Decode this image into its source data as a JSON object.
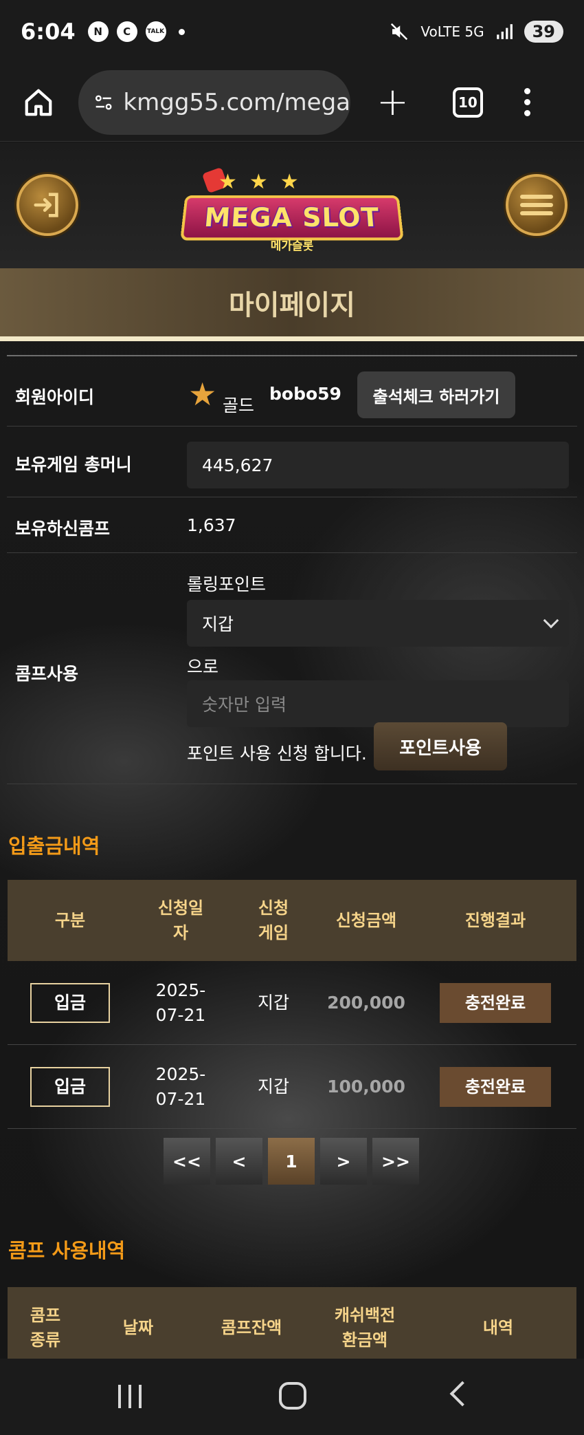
{
  "status_bar": {
    "time": "6:04",
    "notif_icons": [
      "N",
      "C",
      "TALK"
    ],
    "network": "VoLTE 5G",
    "battery": "39"
  },
  "browser": {
    "url": "kmgg55.com/mega",
    "tab_count": "10"
  },
  "site": {
    "logo_title": "MEGA SLOT",
    "logo_sub": "메가슬롯",
    "page_title": "마이페이지"
  },
  "member": {
    "id_label": "회원아이디",
    "grade": "골드",
    "user_id": "bobo59",
    "attendance_button": "출석체크 하러가기",
    "money_label": "보유게임 총머니",
    "money_value": "445,627",
    "comp_label": "보유하신콤프",
    "comp_value": "1,637",
    "use_label": "콤프사용",
    "rolling_label": "롤링포인트",
    "wallet_select": "지갑",
    "to_text": "으로",
    "amount_placeholder": "숫자만 입력",
    "apply_text": "포인트 사용 신청 합니다.",
    "use_point_button": "포인트사용"
  },
  "deposit_history": {
    "title": "입출금내역",
    "headers": [
      "구분",
      "신청일\n자",
      "신청\n게임",
      "신청금액",
      "진행결과"
    ],
    "rows": [
      {
        "type": "입금",
        "date": "2025-\n07-21",
        "game": "지갑",
        "amount": "200,000",
        "status": "충전완료"
      },
      {
        "type": "입금",
        "date": "2025-\n07-21",
        "game": "지갑",
        "amount": "100,000",
        "status": "충전완료"
      }
    ]
  },
  "pagination": {
    "first": "<<",
    "prev": "<",
    "current": "1",
    "next": ">",
    "last": ">>"
  },
  "comp_history": {
    "title": "콤프 사용내역",
    "headers": [
      "콤프\n종류",
      "날짜",
      "콤프잔액",
      "캐쉬백전\n환금액",
      "내역"
    ]
  },
  "colors": {
    "accent_orange": "#f39a18",
    "header_gold": "#f6d48a",
    "status_brown": "#6a4b30"
  }
}
